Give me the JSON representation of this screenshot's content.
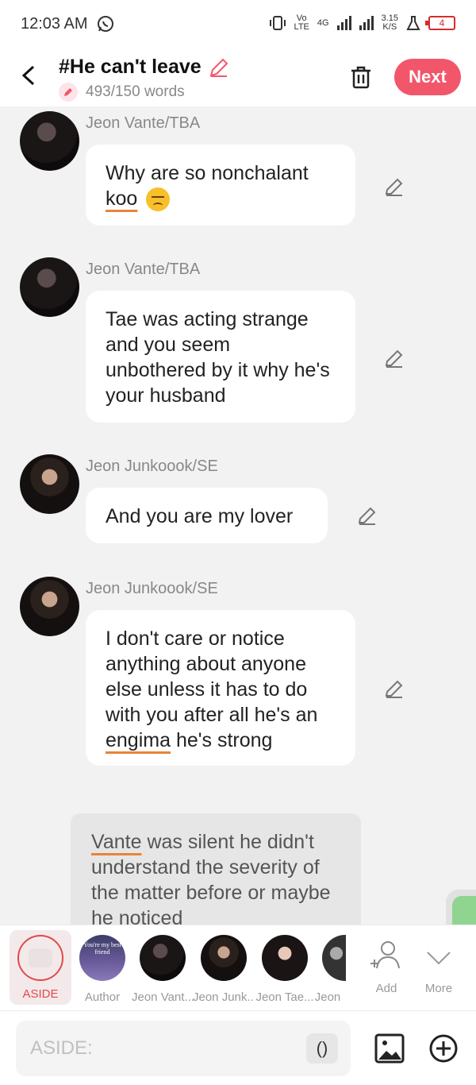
{
  "status_bar": {
    "time": "12:03 AM",
    "network_vo": "Vo",
    "network_lte": "LTE",
    "network_4g": "4G",
    "speed": "3.15",
    "speed_unit": "K/S",
    "battery": "4"
  },
  "header": {
    "title": "#He can't leave",
    "word_count": "493/150 words",
    "next_label": "Next"
  },
  "messages": [
    {
      "sender": "Jeon Vante/TBA",
      "text_plain": "Why are so nonchalant",
      "text_underlined": "koo"
    },
    {
      "sender": "Jeon Vante/TBA",
      "text": "Tae was acting strange and you seem unbothered by it why he's your husband"
    },
    {
      "sender": "Jeon Junkoook/SE",
      "text": "And you are my lover"
    },
    {
      "sender": "Jeon Junkoook/SE",
      "text_plain": "I don't care or notice anything about anyone else unless it has to do with you after all he's an",
      "text_underlined": "engima",
      "text_end": "he's strong"
    }
  ],
  "aside": {
    "underlined": "Vante",
    "text": "was silent he didn't understand the severity of the matter before or maybe he noticed"
  },
  "characters": [
    {
      "label": "ASIDE",
      "active": true
    },
    {
      "label": "Author"
    },
    {
      "label": "Jeon Vant..."
    },
    {
      "label": "Jeon Junk..."
    },
    {
      "label": "Jeon Tae..."
    },
    {
      "label": "Jeon"
    },
    {
      "label": "Add"
    },
    {
      "label": "More"
    }
  ],
  "author_pic_text": "You're my best friend",
  "input": {
    "placeholder": "ASIDE:",
    "paren": "()"
  }
}
